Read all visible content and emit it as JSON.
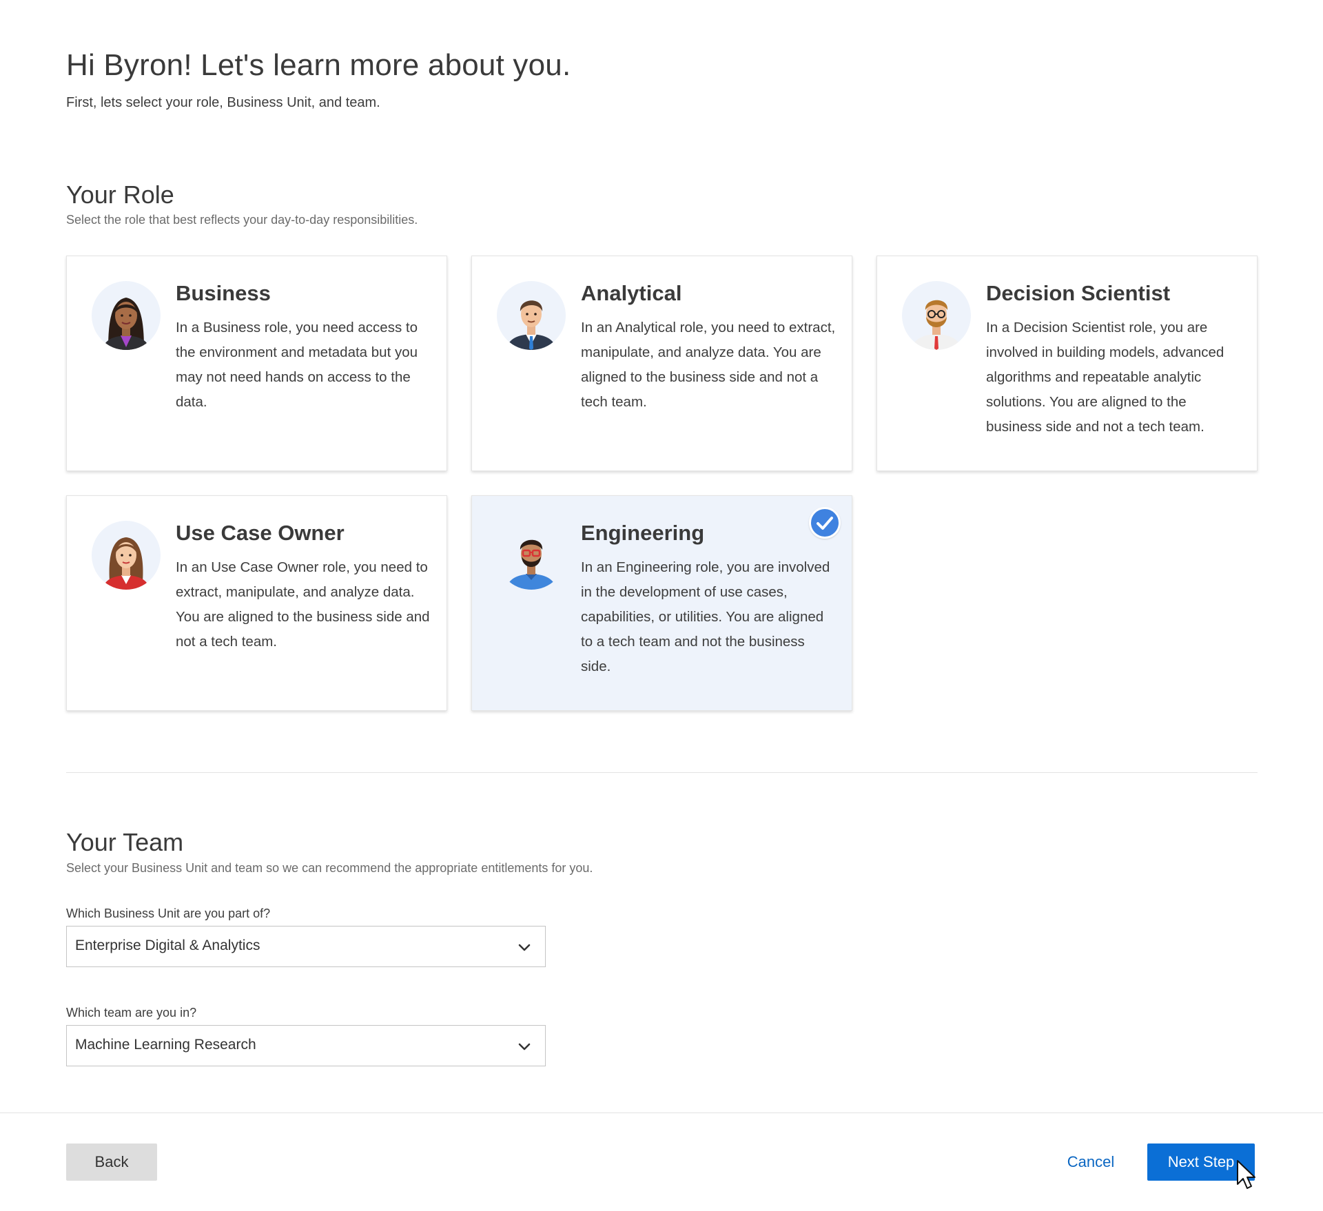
{
  "header": {
    "title": "Hi Byron! Let's learn more about you.",
    "subtitle": "First, lets select your role, Business Unit, and team."
  },
  "role_section": {
    "title": "Your Role",
    "description": "Select the role that best reflects your day-to-day responsibilities.",
    "selected": "Engineering",
    "roles": [
      {
        "title": "Business",
        "description": "In a Business role, you need access to the environment and metadata but you may not need hands on access to the data.",
        "avatar_icon": "woman-purple-blouse-avatar"
      },
      {
        "title": "Analytical",
        "description": "In an Analytical role, you need to extract, manipulate, and analyze data. You are aligned to the business side and not a tech team.",
        "avatar_icon": "man-suit-avatar"
      },
      {
        "title": "Decision Scientist",
        "description": "In a Decision Scientist role, you are involved in building models, advanced algorithms and repeatable analytic solutions. You are aligned to the business side and not a tech team.",
        "avatar_icon": "man-glasses-beard-avatar"
      },
      {
        "title": "Use Case Owner",
        "description": "In an Use Case Owner role, you need to extract, manipulate, and analyze data. You are aligned to the business side and not a tech team.",
        "avatar_icon": "woman-red-jacket-avatar"
      },
      {
        "title": "Engineering",
        "description": "In an Engineering role, you are involved in the development of use cases, capabilities, or utilities. You are aligned to a tech team and not the business side.",
        "avatar_icon": "man-red-glasses-avatar"
      }
    ],
    "check_icon": "checkmark-icon"
  },
  "team_section": {
    "title": "Your Team",
    "description": "Select your Business Unit and team so we can recommend the appropriate entitlements for you.",
    "business_unit_label": "Which Business Unit are you part of?",
    "business_unit_value": "Enterprise Digital & Analytics",
    "team_label": "Which team are you in?",
    "team_value": "Machine Learning Research"
  },
  "footer": {
    "back_label": "Back",
    "cancel_label": "Cancel",
    "next_label": "Next Step"
  },
  "colors": {
    "primary": "#0b6fd6",
    "selected_card_bg": "#eef3fb",
    "check_badge": "#3f82e0",
    "link": "#0a66c2"
  }
}
